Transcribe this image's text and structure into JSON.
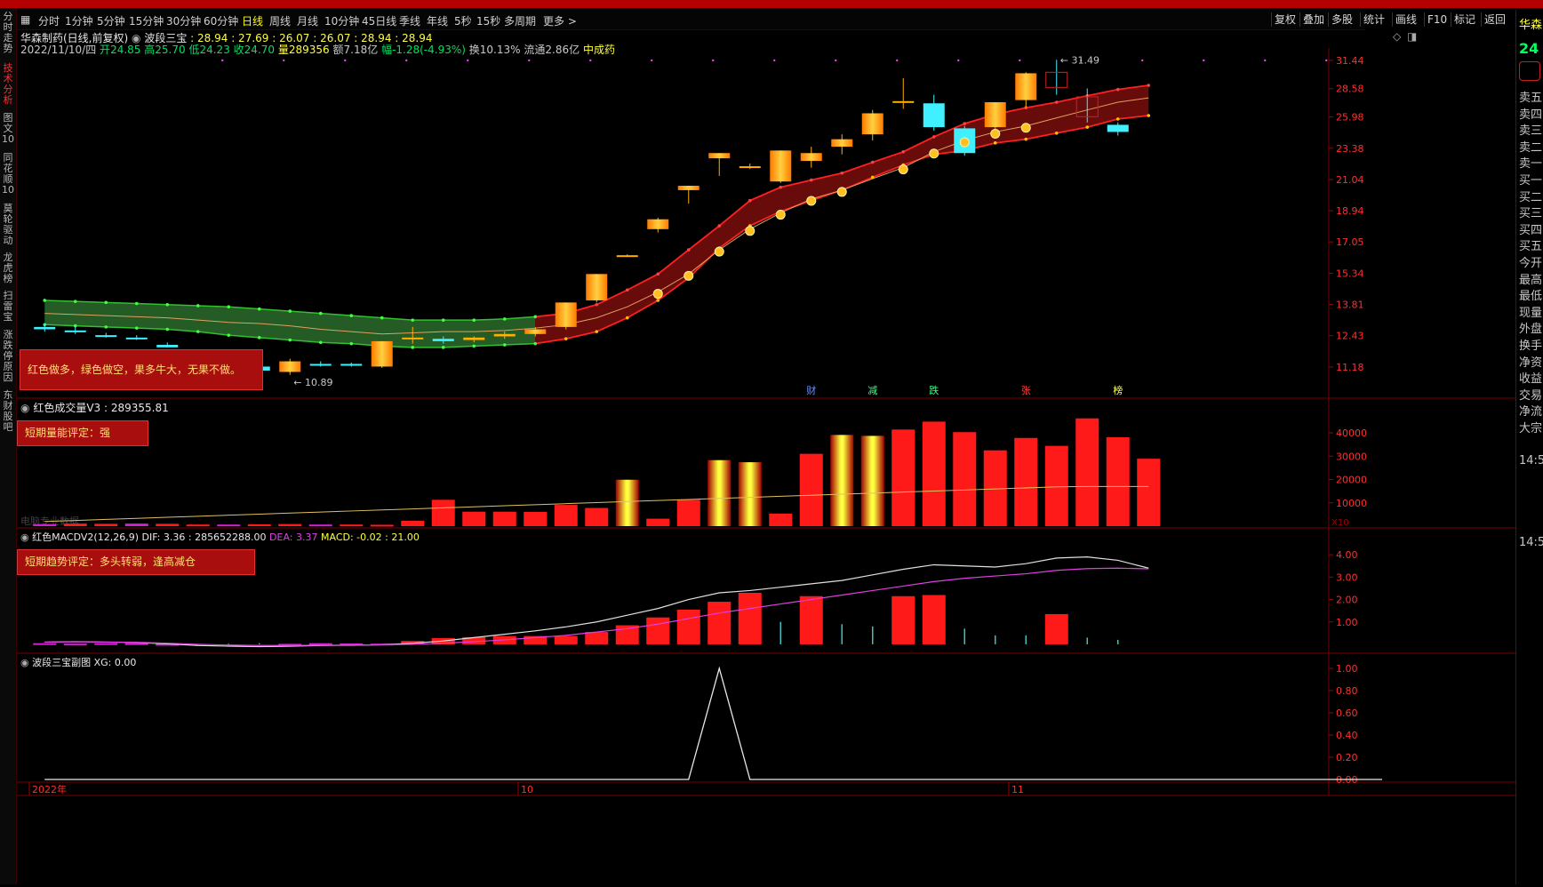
{
  "left_tabs": [
    "分时走势",
    "技术分析",
    "图文10",
    "同花顺10",
    "莫轮驱动",
    "龙虎榜",
    "扫雷宝",
    "涨跌停原因",
    "东财股吧"
  ],
  "toolbar": {
    "periods": [
      "分时",
      "1分钟",
      "5分钟",
      "15分钟",
      "30分钟",
      "60分钟",
      "日线",
      "周线",
      "月线",
      "10分钟",
      "45日线",
      "季线",
      "年线",
      "5秒",
      "15秒",
      "多周期",
      "更多 >"
    ],
    "active_period": "日线",
    "right_buttons": [
      "复权",
      "叠加",
      "多股",
      "统计",
      "画线",
      "F10",
      "标记",
      "返回"
    ]
  },
  "stock": {
    "name_period": "华森制药(日线,前复权)",
    "indicator_title": "波段三宝",
    "indicator_values": ": 28.94 : 27.69 : 26.07 : 26.07 : 28.94 : 28.94",
    "date": "2022/11/10/四",
    "open_label": "开",
    "open": "24.85",
    "high_label": "高",
    "high": "25.70",
    "low_label": "低",
    "low": "24.23",
    "close_label": "收",
    "close": "24.70",
    "vol_label": "量",
    "volume": "289356",
    "amount": "额7.18亿",
    "change": "幅-1.28(-4.93%)",
    "turnover": "换10.13%",
    "float_cap": "流通2.86亿",
    "sector": "中成药"
  },
  "main_panel": {
    "y_ticks": [
      "31.44",
      "28.58",
      "25.98",
      "23.38",
      "21.04",
      "18.94",
      "17.05",
      "15.34",
      "13.81",
      "12.43",
      "11.18"
    ],
    "high_label": "31.49",
    "low_label": "10.89",
    "note": "红色做多，绿色做空，果多牛大，无果不做。",
    "markers": [
      "财",
      "减",
      "跌",
      "张",
      "榜"
    ]
  },
  "volume_panel": {
    "title": "红色成交量V3",
    "value": ": 289355.81",
    "note": "短期量能评定：强",
    "y_ticks": [
      "40000",
      "30000",
      "20000",
      "10000"
    ],
    "unit": "X10",
    "faint_label": "电脑专业数据"
  },
  "macd_panel": {
    "title": "红色MACDV2(12,26,9)",
    "dif": "DIF: 3.36 : 285652288.00",
    "dea": "DEA: 3.37",
    "macd": "MACD: -0.02 : 21.00",
    "note": "短期趋势评定：多头转弱，逢高减仓",
    "y_ticks": [
      "4.00",
      "3.00",
      "2.00",
      "1.00"
    ]
  },
  "sub_panel": {
    "title": "波段三宝副图",
    "xg": "XG: 0.00",
    "y_ticks": [
      "1.00",
      "0.80",
      "0.60",
      "0.40",
      "0.20",
      "0.00"
    ]
  },
  "x_axis": {
    "labels": [
      "2022年",
      "10",
      "11"
    ]
  },
  "right_panel": {
    "title": "华森",
    "price": "24",
    "labels": [
      "卖五",
      "卖四",
      "卖三",
      "卖二",
      "卖一",
      "买一",
      "买二",
      "买三",
      "买四",
      "买五",
      "今开",
      "最高",
      "最低",
      "现量",
      "外盘",
      "换手",
      "净资",
      "收益",
      "交易",
      "净流",
      "大宗"
    ],
    "times": [
      "14:5",
      "14:5"
    ]
  },
  "colors": {
    "up": "#ff1a1a",
    "down": "#40f0ff",
    "gold": "#ffb000",
    "band_red": "#7a0d0d",
    "band_green": "#2c6b2c"
  },
  "chart_data": {
    "type": "candlestick",
    "ylim": [
      10.5,
      32.0
    ],
    "candles": [
      {
        "o": 12.8,
        "h": 12.95,
        "l": 12.6,
        "c": 12.7
      },
      {
        "o": 12.65,
        "h": 12.8,
        "l": 12.5,
        "c": 12.6
      },
      {
        "o": 12.45,
        "h": 12.55,
        "l": 12.35,
        "c": 12.4
      },
      {
        "o": 12.35,
        "h": 12.45,
        "l": 12.25,
        "c": 12.3
      },
      {
        "o": 12.05,
        "h": 12.15,
        "l": 11.95,
        "c": 11.95
      },
      {
        "o": 11.6,
        "h": 11.75,
        "l": 11.5,
        "c": 11.55
      },
      {
        "o": 11.45,
        "h": 11.6,
        "l": 11.35,
        "c": 11.4
      },
      {
        "o": 11.2,
        "h": 11.3,
        "l": 11.0,
        "c": 11.05
      },
      {
        "o": 11.0,
        "h": 11.5,
        "l": 10.89,
        "c": 11.4
      },
      {
        "o": 11.3,
        "h": 11.4,
        "l": 11.2,
        "c": 11.25
      },
      {
        "o": 11.3,
        "h": 11.35,
        "l": 11.2,
        "c": 11.25
      },
      {
        "o": 11.2,
        "h": 12.2,
        "l": 11.15,
        "c": 12.2
      },
      {
        "o": 12.3,
        "h": 12.8,
        "l": 12.1,
        "c": 12.35
      },
      {
        "o": 12.3,
        "h": 12.4,
        "l": 12.1,
        "c": 12.2
      },
      {
        "o": 12.25,
        "h": 12.4,
        "l": 12.15,
        "c": 12.35
      },
      {
        "o": 12.4,
        "h": 12.6,
        "l": 12.3,
        "c": 12.5
      },
      {
        "o": 12.5,
        "h": 12.8,
        "l": 12.4,
        "c": 12.7
      },
      {
        "o": 12.8,
        "h": 13.9,
        "l": 12.7,
        "c": 13.9
      },
      {
        "o": 14.0,
        "h": 15.3,
        "l": 13.9,
        "c": 15.3
      },
      {
        "o": 16.3,
        "h": 16.35,
        "l": 16.2,
        "c": 16.3
      },
      {
        "o": 17.8,
        "h": 18.5,
        "l": 17.6,
        "c": 18.4
      },
      {
        "o": 20.3,
        "h": 20.6,
        "l": 19.4,
        "c": 20.6
      },
      {
        "o": 22.6,
        "h": 23.0,
        "l": 21.3,
        "c": 23.0
      },
      {
        "o": 21.9,
        "h": 22.2,
        "l": 21.8,
        "c": 22.0
      },
      {
        "o": 20.9,
        "h": 23.2,
        "l": 20.8,
        "c": 23.2
      },
      {
        "o": 22.4,
        "h": 23.5,
        "l": 21.9,
        "c": 23.0
      },
      {
        "o": 23.5,
        "h": 24.5,
        "l": 22.9,
        "c": 24.1
      },
      {
        "o": 24.5,
        "h": 26.6,
        "l": 24.0,
        "c": 26.3
      },
      {
        "o": 27.3,
        "h": 29.6,
        "l": 26.7,
        "c": 27.4
      },
      {
        "o": 27.2,
        "h": 28.0,
        "l": 24.8,
        "c": 25.1
      },
      {
        "o": 25.0,
        "h": 25.2,
        "l": 22.8,
        "c": 23.0
      },
      {
        "o": 25.1,
        "h": 27.3,
        "l": 24.9,
        "c": 27.3
      },
      {
        "o": 27.5,
        "h": 30.2,
        "l": 26.8,
        "c": 30.1
      },
      {
        "o": 30.2,
        "h": 31.49,
        "l": 28.0,
        "c": 28.7
      },
      {
        "o": 27.8,
        "h": 28.6,
        "l": 25.5,
        "c": 26.0
      },
      {
        "o": 25.3,
        "h": 25.5,
        "l": 24.4,
        "c": 24.7
      }
    ],
    "volume": [
      900,
      1100,
      1000,
      1100,
      1000,
      700,
      700,
      800,
      900,
      700,
      700,
      600,
      2300,
      11300,
      6200,
      6200,
      6100,
      9100,
      7800,
      19900,
      3200,
      11300,
      28300,
      27400,
      5400,
      31000,
      39100,
      38700,
      41400,
      44800,
      40300,
      32500,
      37800,
      34400,
      46200,
      38100,
      28900
    ],
    "macd_hist": [
      0.05,
      0.03,
      0.05,
      0.05,
      0.02,
      -0.01,
      -0.03,
      -0.05,
      0.02,
      0.05,
      0.04,
      0.03,
      0.15,
      0.28,
      0.32,
      0.37,
      0.37,
      0.37,
      0.55,
      0.85,
      1.2,
      1.55,
      1.9,
      2.3,
      -1,
      2.15,
      -0.9,
      -0.8,
      2.15,
      2.2,
      -0.7,
      -0.4,
      -0.4,
      1.35,
      -0.3,
      -0.2
    ],
    "dif": [
      0.1,
      0.12,
      0.1,
      0.08,
      0.02,
      -0.05,
      -0.08,
      -0.1,
      -0.08,
      -0.05,
      -0.04,
      -0.02,
      0.05,
      0.15,
      0.3,
      0.45,
      0.6,
      0.78,
      1.0,
      1.3,
      1.6,
      2.0,
      2.3,
      2.4,
      2.55,
      2.7,
      2.85,
      3.1,
      3.35,
      3.55,
      3.5,
      3.45,
      3.6,
      3.85,
      3.9,
      3.75,
      3.4
    ],
    "dea": [
      0.1,
      0.11,
      0.1,
      0.09,
      0.05,
      0.0,
      -0.03,
      -0.05,
      -0.05,
      -0.04,
      -0.03,
      -0.02,
      0.0,
      0.05,
      0.12,
      0.2,
      0.3,
      0.4,
      0.55,
      0.7,
      0.9,
      1.15,
      1.4,
      1.6,
      1.8,
      2.0,
      2.2,
      2.4,
      2.6,
      2.8,
      2.95,
      3.05,
      3.15,
      3.3,
      3.38,
      3.4,
      3.37
    ],
    "signal": [
      0,
      0,
      0,
      0,
      0,
      0,
      0,
      0,
      0,
      0,
      0,
      0,
      0,
      0,
      0,
      0,
      0,
      0,
      0,
      0,
      0,
      0,
      1,
      0,
      0,
      0,
      0,
      0,
      0,
      0,
      0,
      0,
      0,
      0,
      0,
      0,
      0
    ],
    "band_mid": [
      13.4,
      13.35,
      13.3,
      13.25,
      13.2,
      13.1,
      13.0,
      12.95,
      12.85,
      12.7,
      12.6,
      12.5,
      12.55,
      12.6,
      12.6,
      12.65,
      12.75,
      12.9,
      13.2,
      13.7,
      14.4,
      15.3,
      16.6,
      17.8,
      18.8,
      19.7,
      20.3,
      21.1,
      21.9,
      23.1,
      24.0,
      24.7,
      25.2,
      25.9,
      26.6,
      27.3,
      27.7
    ],
    "band_top": [
      14.0,
      13.95,
      13.9,
      13.85,
      13.8,
      13.75,
      13.7,
      13.6,
      13.5,
      13.4,
      13.3,
      13.2,
      13.1,
      13.1,
      13.1,
      13.15,
      13.25,
      13.4,
      13.8,
      14.5,
      15.3,
      16.6,
      18.0,
      19.6,
      20.5,
      21.0,
      21.5,
      22.3,
      23.1,
      24.3,
      25.4,
      26.2,
      26.8,
      27.3,
      27.9,
      28.5,
      28.9
    ],
    "band_bot": [
      12.9,
      12.85,
      12.8,
      12.75,
      12.7,
      12.6,
      12.45,
      12.35,
      12.25,
      12.15,
      12.1,
      12.0,
      11.95,
      11.95,
      12.0,
      12.05,
      12.1,
      12.3,
      12.6,
      13.2,
      14.0,
      15.1,
      16.7,
      18.0,
      18.9,
      19.6,
      20.3,
      21.2,
      22.1,
      22.9,
      23.2,
      23.8,
      24.1,
      24.6,
      25.1,
      25.8,
      26.1
    ],
    "fruits": [
      false,
      false,
      false,
      false,
      false,
      false,
      false,
      false,
      false,
      false,
      false,
      false,
      false,
      false,
      false,
      false,
      false,
      false,
      false,
      false,
      true,
      true,
      true,
      true,
      true,
      true,
      true,
      false,
      true,
      true,
      true,
      true,
      true,
      false,
      false,
      false,
      false
    ]
  }
}
